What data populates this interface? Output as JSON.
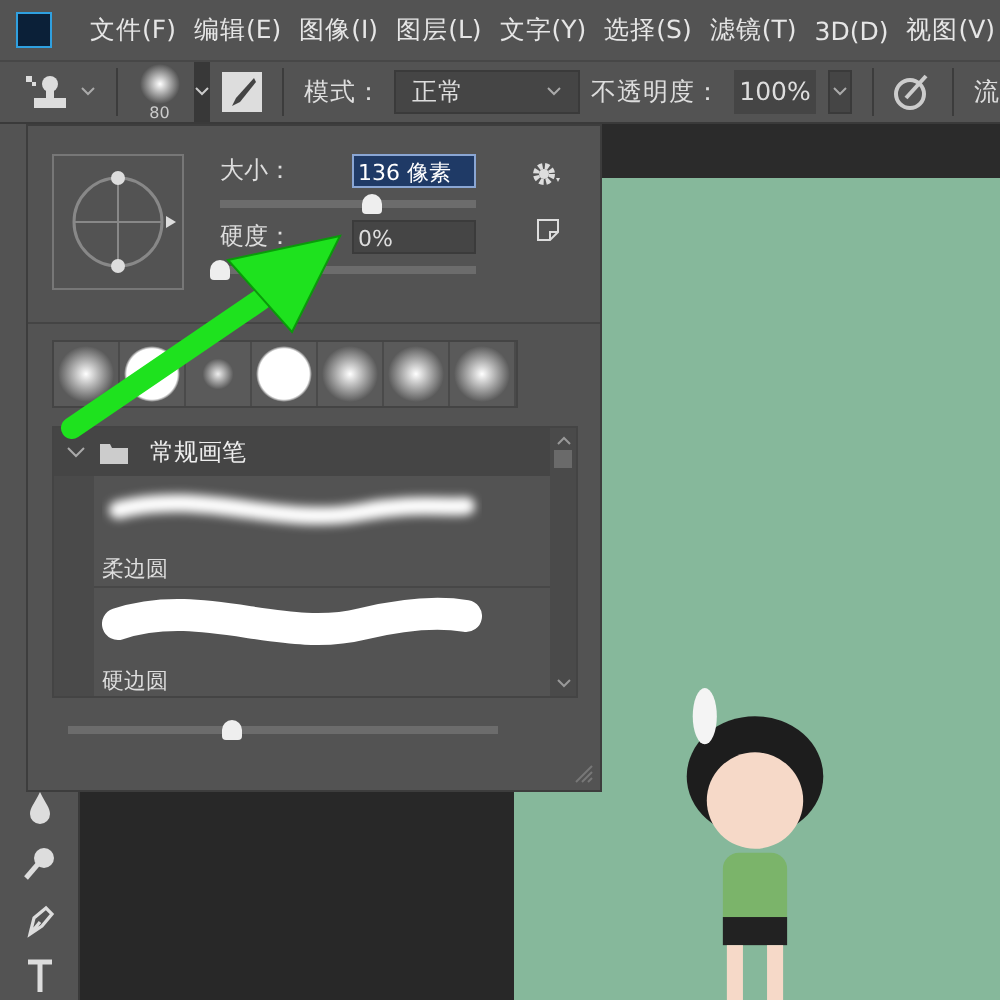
{
  "menu": {
    "items": [
      "文件(F)",
      "编辑(E)",
      "图像(I)",
      "图层(L)",
      "文字(Y)",
      "选择(S)",
      "滤镜(T)",
      "3D(D)",
      "视图(V)"
    ]
  },
  "options_bar": {
    "brush_size": "80",
    "mode_label": "模式：",
    "mode": "正常",
    "opacity_label": "不透明度：",
    "opacity": "100%",
    "flow_label": "流"
  },
  "brush_panel": {
    "size_label": "大小：",
    "size_value": "136 像素",
    "size_slider": {
      "level": 0.59
    },
    "hardness_label": "硬度：",
    "hardness_value": "0%",
    "hardness_slider": {
      "level": 0
    },
    "tips": [
      {
        "kind": "soft"
      },
      {
        "kind": "hard"
      },
      {
        "kind": "small"
      },
      {
        "kind": "hard"
      },
      {
        "kind": "soft"
      },
      {
        "kind": "soft"
      },
      {
        "kind": "soft"
      }
    ],
    "group": {
      "name": "常规画笔",
      "expanded": true,
      "brushes": [
        {
          "name": "柔边圆",
          "kind": "soft"
        },
        {
          "name": "硬边圆",
          "kind": "hard"
        }
      ]
    },
    "preview_slider": {
      "level": 0.38
    }
  }
}
